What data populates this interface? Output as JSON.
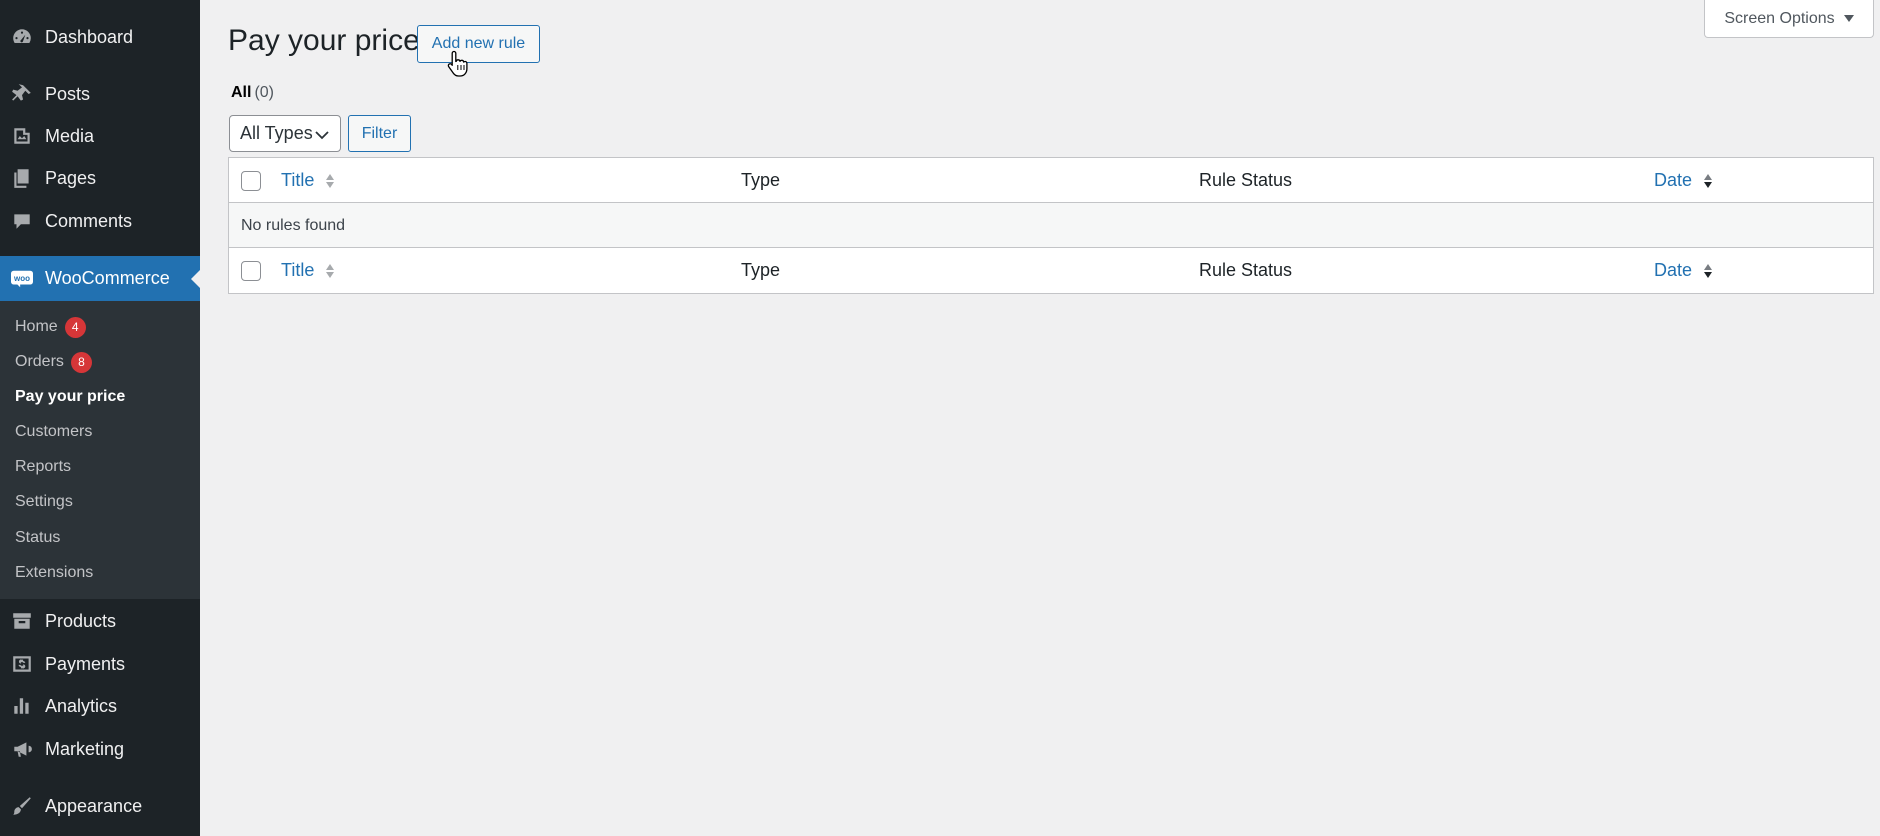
{
  "sidebar": {
    "items": [
      {
        "label": "Dashboard",
        "icon": "dashboard-icon"
      },
      {
        "label": "Posts",
        "icon": "pin-icon"
      },
      {
        "label": "Media",
        "icon": "media-icon"
      },
      {
        "label": "Pages",
        "icon": "pages-icon"
      },
      {
        "label": "Comments",
        "icon": "comment-icon"
      },
      {
        "label": "WooCommerce",
        "icon": "woo-icon"
      },
      {
        "label": "Products",
        "icon": "archive-icon"
      },
      {
        "label": "Payments",
        "icon": "dollar-icon"
      },
      {
        "label": "Analytics",
        "icon": "chart-bar-icon"
      },
      {
        "label": "Marketing",
        "icon": "megaphone-icon"
      },
      {
        "label": "Appearance",
        "icon": "brush-icon"
      }
    ],
    "woo_icon_text": "woo",
    "submenu": [
      {
        "label": "Home",
        "badge": "4"
      },
      {
        "label": "Orders",
        "badge": "8"
      },
      {
        "label": "Pay your price"
      },
      {
        "label": "Customers"
      },
      {
        "label": "Reports"
      },
      {
        "label": "Settings"
      },
      {
        "label": "Status"
      },
      {
        "label": "Extensions"
      }
    ]
  },
  "header": {
    "screen_options": "Screen Options",
    "title": "Pay your price",
    "add_new": "Add new rule"
  },
  "filters": {
    "all_label": "All",
    "all_count": "(0)",
    "type_select": "All Types",
    "filter_button": "Filter"
  },
  "table": {
    "columns": [
      "Title",
      "Type",
      "Rule Status",
      "Date"
    ],
    "empty_message": "No rules found"
  },
  "colors": {
    "sidebar_bg": "#1d2327",
    "accent": "#2271b1",
    "badge": "#d63638"
  }
}
